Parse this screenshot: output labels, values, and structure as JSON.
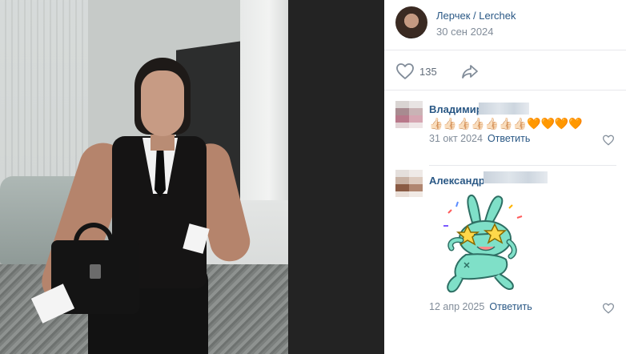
{
  "post": {
    "author": "Лерчек / Lerchek",
    "date": "30 сен 2024",
    "likes": "135"
  },
  "comments": [
    {
      "name": "Владимир",
      "emojis": "👍🏻👍🏻👍🏻👍🏻👍🏻👍🏻👍🏻🧡🧡🧡🧡",
      "date": "31 окт 2024",
      "reply": "Ответить"
    },
    {
      "name": "Александр",
      "sticker": "bunny-with-star-glasses-sticker",
      "date": "12 апр 2025",
      "reply": "Ответить"
    }
  ],
  "colors": {
    "link": "#2a5885",
    "meta": "#818c99",
    "divider": "#e7e8ec",
    "sticker_body": "#7fe0c8"
  }
}
